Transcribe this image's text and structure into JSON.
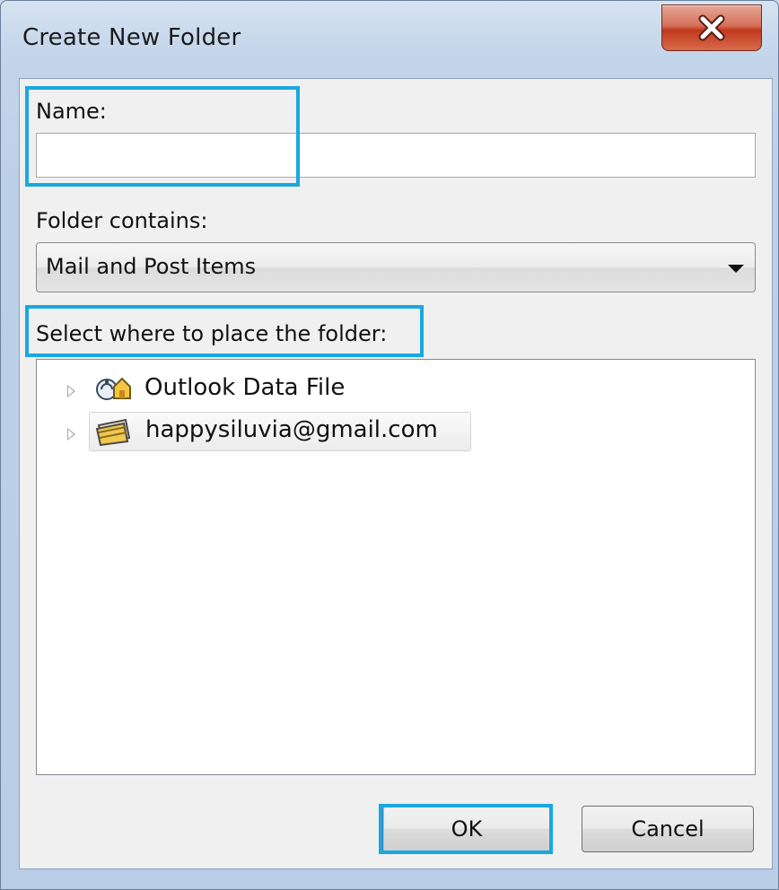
{
  "window": {
    "title": "Create New Folder"
  },
  "form": {
    "name_label": "Name:",
    "name_value": "",
    "folder_contains_label": "Folder contains:",
    "folder_contains_value": "Mail and Post Items",
    "location_label": "Select where to place the folder:"
  },
  "tree": {
    "items": [
      {
        "label": "Outlook Data File",
        "icon": "outlook-data-file-icon",
        "selected": false
      },
      {
        "label": "happysiluvia@gmail.com",
        "icon": "mail-account-icon",
        "selected": true
      }
    ]
  },
  "buttons": {
    "ok_label": "OK",
    "cancel_label": "Cancel"
  },
  "colors": {
    "highlight": "#19a8e0",
    "close_button": "#c1391e"
  }
}
